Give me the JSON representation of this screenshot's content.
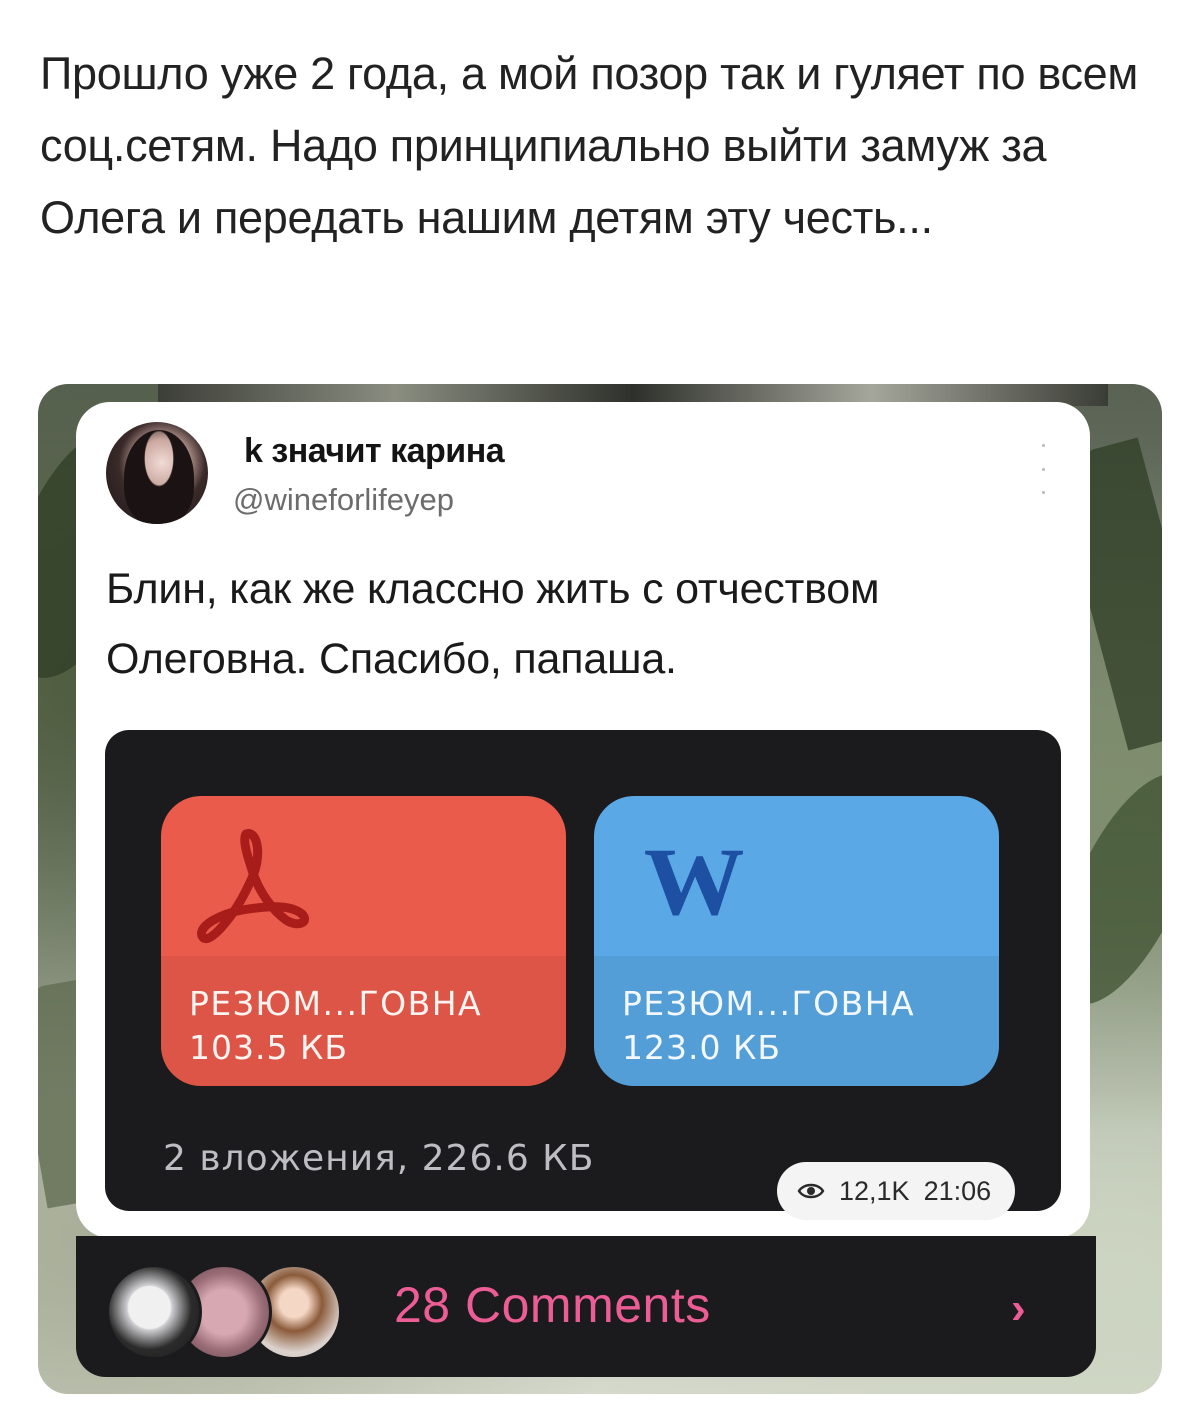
{
  "caption": "Прошло уже 2 года, а мой позор так и гуляет по всем соц.сетям. Надо принципиально выйти замуж за Олега и передать нашим детям эту честь...",
  "tweet": {
    "author": "k значит карина",
    "handle": "@wineforlifeyep",
    "text": "Блин, как же классно жить с отчеством Олеговна. Спасибо, папаша."
  },
  "message": {
    "files": [
      {
        "type": "pdf",
        "icon": "acrobat-pdf-icon",
        "color": "#ea5b4c",
        "name": "РЕЗЮМ...ГОВНА",
        "size": "103.5 КБ"
      },
      {
        "type": "word",
        "icon": "word-w-icon",
        "color": "#5aa8e6",
        "name": "РЕЗЮМ...ГОВНА",
        "size": "123.0 КБ"
      }
    ],
    "word_icon_letter": "W",
    "attachments_summary": "2 вложения, 226.6 КБ",
    "views": "12,1K",
    "time": "21:06"
  },
  "comments": {
    "label": "28 Comments",
    "chevron": "›",
    "accent": "#ec5d95"
  }
}
